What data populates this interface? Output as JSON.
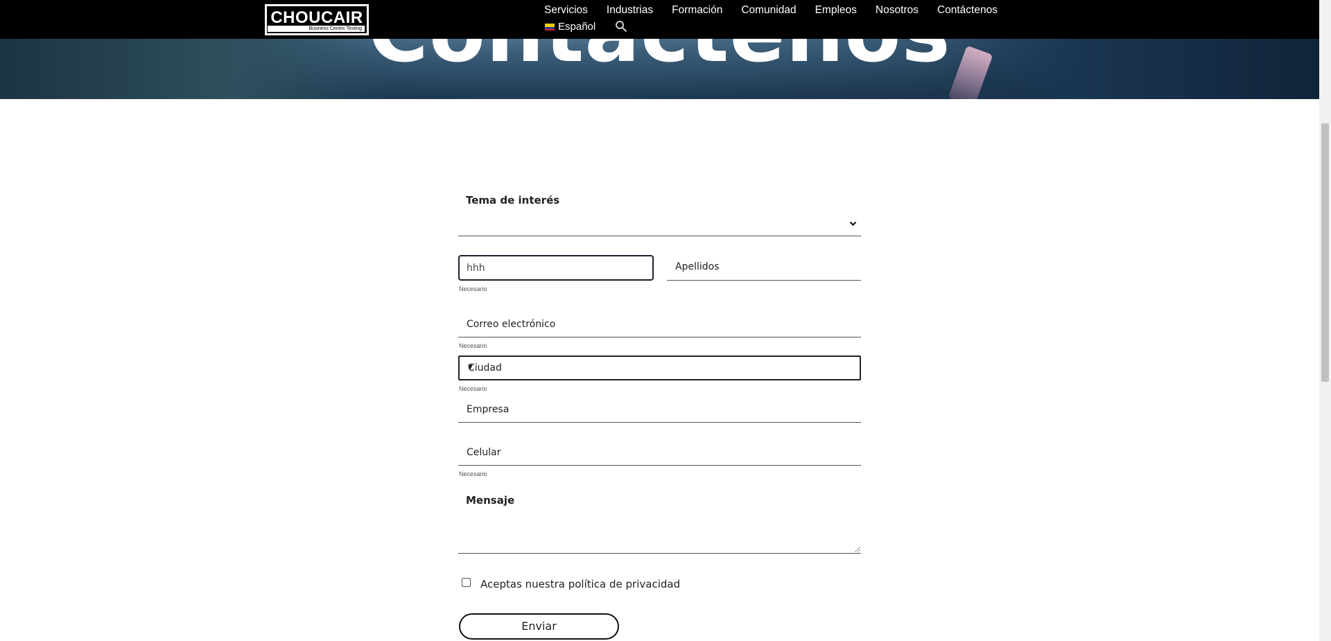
{
  "header": {
    "logo_text": "CHOUCAIR",
    "logo_tagline": "Business Centric Testing",
    "nav": [
      "Servicios",
      "Industrias",
      "Formación",
      "Comunidad",
      "Empleos",
      "Nosotros",
      "Contáctenos"
    ],
    "language": "Español"
  },
  "hero": {
    "title": "Contáctenos"
  },
  "form": {
    "topic_label": "Tema de interés",
    "first_name_value": "hhh",
    "last_name_label": "Apellidos",
    "required_hint": "Necesario",
    "email_label": "Correo electrónico",
    "city_selected": "Ciudad",
    "company_label": "Empresa",
    "cell_label": "Celular",
    "message_label": "Mensaje",
    "privacy_label": "Aceptas nuestra política de privacidad",
    "submit_label": "Enviar"
  }
}
